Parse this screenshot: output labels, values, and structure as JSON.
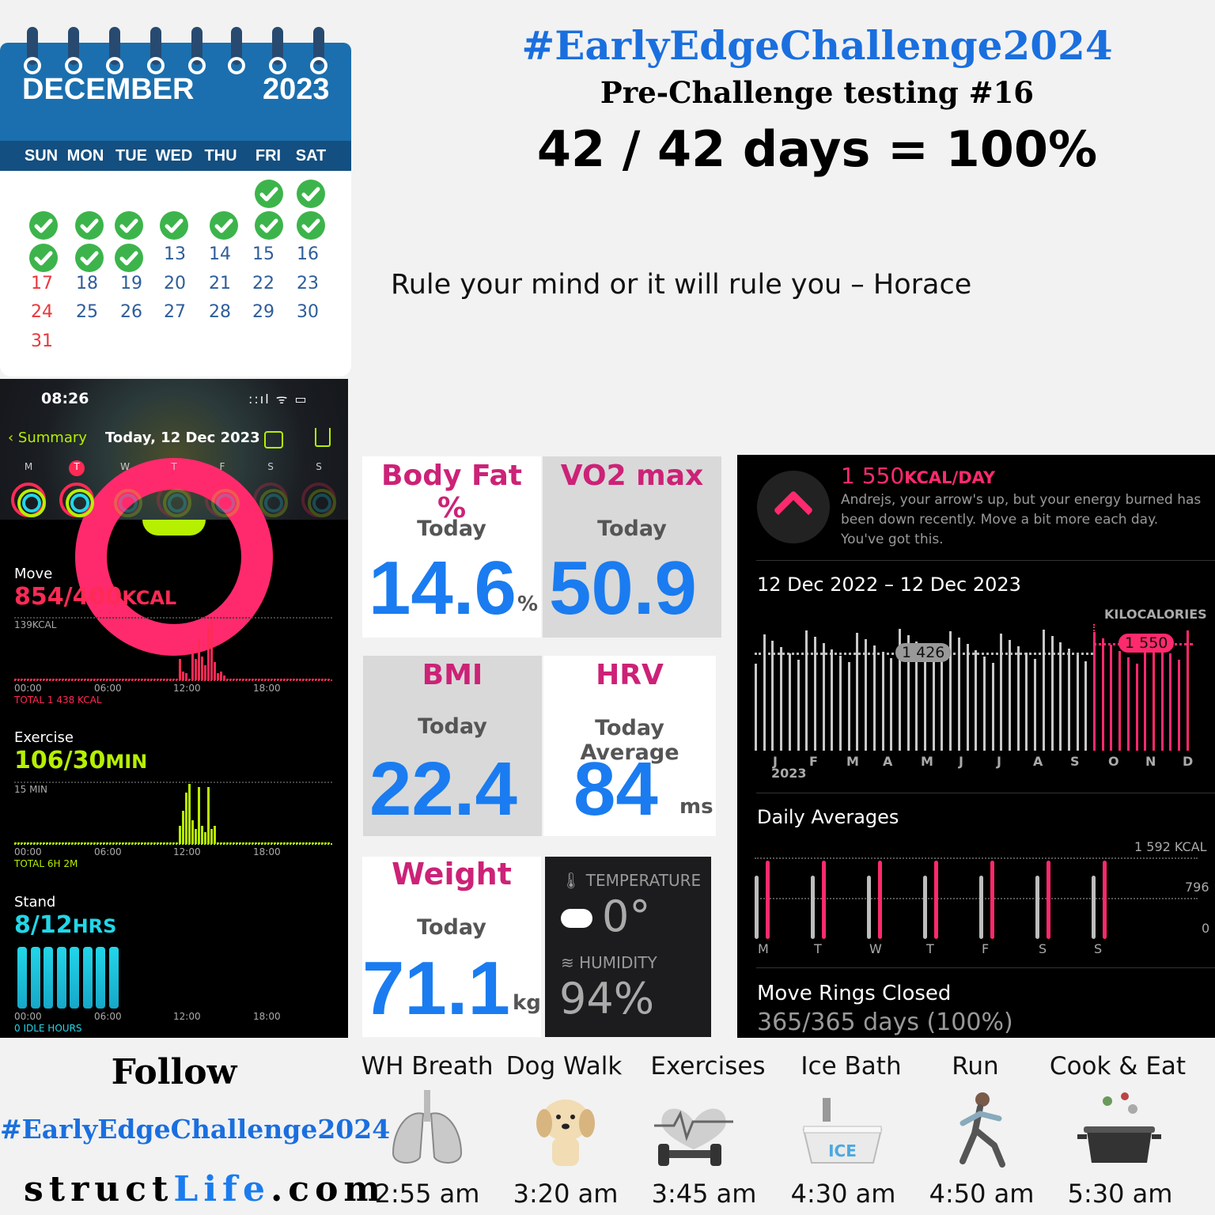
{
  "calendar": {
    "month": "DECEMBER",
    "year": "2023",
    "day_names": [
      "SUN",
      "MON",
      "TUE",
      "WED",
      "THU",
      "FRI",
      "SAT"
    ],
    "days": [
      "13",
      "14",
      "15",
      "16",
      "17",
      "18",
      "19",
      "20",
      "21",
      "22",
      "23",
      "24",
      "25",
      "26",
      "27",
      "28",
      "29",
      "30",
      "31"
    ],
    "checked_days": 12
  },
  "header": {
    "title": "#EarlyEdgeChallenge2024",
    "subtitle": "Pre-Challenge testing #16",
    "days": "42 / 42 days = 100%",
    "quote": "Rule your mind or it will rule you – Horace"
  },
  "phone": {
    "time": "08:26",
    "status": "::ıl ᯤ ▭",
    "back": "Summary",
    "date": "Today, 12 Dec 2023",
    "week": [
      "M",
      "T",
      "W",
      "T",
      "F",
      "S",
      "S"
    ],
    "move": {
      "label": "Move",
      "value": "854/400",
      "unit": "KCAL",
      "max": "139KCAL",
      "total": "TOTAL 1 438 KCAL",
      "color": "#ff2a55"
    },
    "exercise": {
      "label": "Exercise",
      "value": "106/30",
      "unit": "MIN",
      "max": "15 MIN",
      "total": "TOTAL 6H 2M",
      "color": "#b6f000"
    },
    "stand": {
      "label": "Stand",
      "value": "8/12",
      "unit": "HRS",
      "total": "0 IDLE HOURS",
      "color": "#22d6e8"
    },
    "ticks": [
      "00:00",
      "06:00",
      "12:00",
      "18:00"
    ]
  },
  "tiles": {
    "body_fat": {
      "name": "Body Fat %",
      "sub": "Today",
      "value": "14.6",
      "unit": "%"
    },
    "vo2": {
      "name": "VO2 max",
      "sub": "Today",
      "value": "50.9"
    },
    "bmi": {
      "name": "BMI",
      "sub": "Today",
      "value": "22.4"
    },
    "hrv": {
      "name": "HRV",
      "sub": "Today Average",
      "value": "84",
      "unit": "ms"
    },
    "weight": {
      "name": "Weight",
      "sub": "Today",
      "value": "71.1",
      "unit": "kg"
    }
  },
  "weather": {
    "temp_label": "🌡 TEMPERATURE",
    "temp": "0°",
    "hum_label": "≋ HUMIDITY",
    "humidity": "94%"
  },
  "trends": {
    "kcal": "1 550",
    "kcal_unit": "KCAL/DAY",
    "message": "Andrejs, your arrow's up, but your energy burned has been down recently. Move a bit more each day. You've got this.",
    "range": "12 Dec 2022 – 12 Dec 2023",
    "axis_label": "KILOCALORIES",
    "avg_year": "1 426",
    "avg_recent": "1 550",
    "months": [
      "J",
      "F",
      "M",
      "A",
      "M",
      "J",
      "J",
      "A",
      "S",
      "O",
      "N",
      "D"
    ],
    "year_label": "2023",
    "daily_title": "Daily Averages",
    "daily_y": [
      "1 592 KCAL",
      "796",
      "0"
    ],
    "daily_days": [
      "M",
      "T",
      "W",
      "T",
      "F",
      "S",
      "S"
    ],
    "rings_title": "Move Rings Closed",
    "rings_value": "365/365 days (100%)"
  },
  "footer": {
    "follow": "Follow",
    "tag": "#EarlyEdgeChallenge2024",
    "site_a": "struct",
    "site_b": "Life",
    "site_c": ".com",
    "activities": [
      {
        "name": "WH Breath",
        "time": "2:55 am",
        "icon": "lungs-icon"
      },
      {
        "name": "Dog Walk",
        "time": "3:20 am",
        "icon": "puppy-icon"
      },
      {
        "name": "Exercises",
        "time": "3:45 am",
        "icon": "dumbbell-heart-icon"
      },
      {
        "name": "Ice Bath",
        "time": "4:30 am",
        "icon": "ice-bath-icon"
      },
      {
        "name": "Run",
        "time": "4:50 am",
        "icon": "runner-icon"
      },
      {
        "name": "Cook & Eat",
        "time": "5:30 am",
        "icon": "cooking-pot-icon"
      }
    ]
  }
}
